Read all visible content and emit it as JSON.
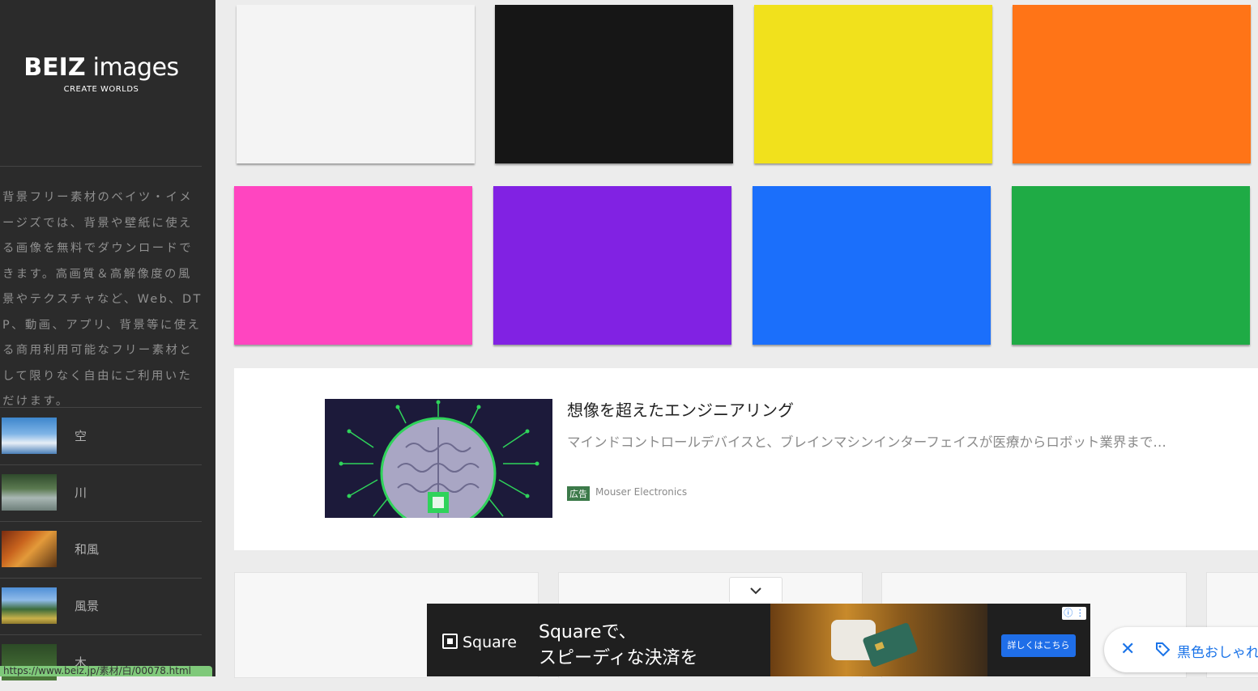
{
  "sidebar": {
    "logo_brand_bold": "BEIZ",
    "logo_brand_rest": " images",
    "logo_tagline": "CREATE WORLDS",
    "description": "背景フリー素材のベイツ・イメージズでは、背景や壁紙に使える画像を無料でダウンロードできます。高画質＆高解像度の風景やテクスチャなど、Web、DTP、動画、アプリ、背景等に使える商用利用可能なフリー素材として限りなく自由にご利用いただけます。",
    "categories": [
      {
        "label": "空"
      },
      {
        "label": "川"
      },
      {
        "label": "和風"
      },
      {
        "label": "風景"
      },
      {
        "label": "木"
      }
    ]
  },
  "status_bar": {
    "url": "https://www.beiz.jp/素材/白/00078.html"
  },
  "tiles": [
    {
      "color": "#f4f4f4"
    },
    {
      "color": "#161616"
    },
    {
      "color": "#f1e11c"
    },
    {
      "color": "#ff7417"
    },
    {
      "color": "#ff45c0"
    },
    {
      "color": "#8122e3"
    },
    {
      "color": "#1b6ffb"
    },
    {
      "color": "#1fab45"
    }
  ],
  "ad_card": {
    "title": "想像を超えたエンジニアリング",
    "description": "マインドコントロールデバイスと、ブレインマシンインターフェイスが医療からロボット業界まで…",
    "badge": "広告",
    "source": "Mouser Electronics"
  },
  "bottom_ad": {
    "brand": "Square",
    "headline_line1": "Squareで、",
    "headline_line2": "スピーディな決済を",
    "cta": "詳しくはこちら",
    "info": "ⓘ ⋮"
  },
  "search_pill": {
    "text": "黒色おしゃれ"
  },
  "icons": {
    "close": "close-icon",
    "tag": "tag-icon",
    "chevron": "chevron-down-icon"
  }
}
